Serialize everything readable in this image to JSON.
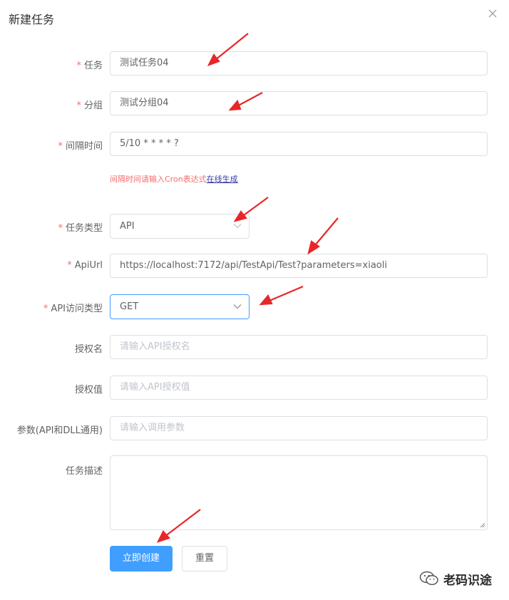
{
  "dialog": {
    "title": "新建任务"
  },
  "form": {
    "task": {
      "required": "*",
      "label": "任务",
      "value": "测试任务04"
    },
    "group": {
      "required": "*",
      "label": "分组",
      "value": "测试分组04"
    },
    "interval": {
      "required": "*",
      "label": "间隔时间",
      "value": "5/10 * * * * ?",
      "hint": "间隔时间请输入Cron表达式",
      "hint_link": "在线生成"
    },
    "task_type": {
      "required": "*",
      "label": "任务类型",
      "value": "API"
    },
    "api_url": {
      "required": "*",
      "label": "ApiUrl",
      "value": "https://localhost:7172/api/TestApi/Test?parameters=xiaoli"
    },
    "api_method": {
      "required": "*",
      "label": "API访问类型",
      "value": "GET"
    },
    "auth_name": {
      "label": "授权名",
      "placeholder": "请输入API授权名"
    },
    "auth_value": {
      "label": "授权值",
      "placeholder": "请输入API授权值"
    },
    "params": {
      "label": "参数(API和DLL通用)",
      "placeholder": "请输入调用参数"
    },
    "description": {
      "label": "任务描述",
      "value": ""
    }
  },
  "buttons": {
    "create": "立即创建",
    "reset": "重置"
  },
  "watermark": {
    "text": "老码识途"
  },
  "colors": {
    "primary": "#409eff",
    "required": "#f56c6c",
    "border": "#dcdfe6",
    "arrow": "#e8262a"
  },
  "icons": {
    "close": "close-icon",
    "select": "chevron-down-icon",
    "annotation": "arrow-annotation",
    "watermark": "wechat-icon"
  }
}
